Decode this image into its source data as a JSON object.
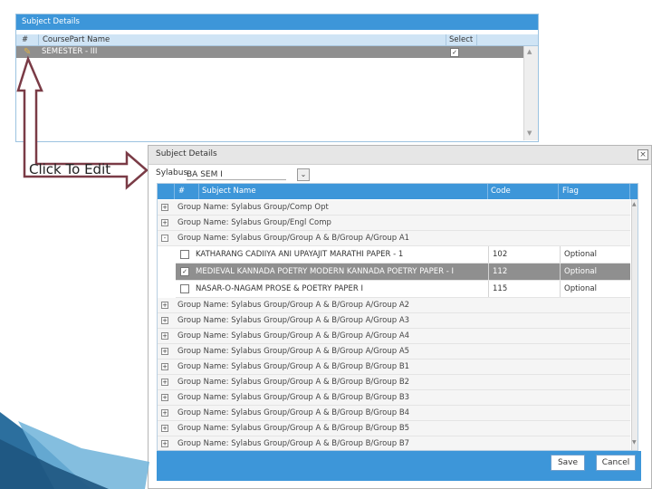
{
  "top_panel": {
    "title": "Subject Details",
    "columns": [
      "#",
      "CoursePart Name",
      "Select"
    ],
    "row": {
      "name": "SEMESTER - III",
      "selected": true
    }
  },
  "annotation": {
    "text": "Click To Edit"
  },
  "dialog": {
    "title": "Subject Details",
    "syllabus_label": "Sylabus",
    "syllabus_value": "BA SEM I",
    "columns": {
      "num": "#",
      "name": "Subject Name",
      "code": "Code",
      "flag": "Flag"
    },
    "groups_top": [
      {
        "label": "Group Name: Sylabus Group/Comp Opt",
        "expander": "+"
      },
      {
        "label": "Group Name: Sylabus Group/Engl Comp",
        "expander": "+"
      },
      {
        "label": "Group Name: Sylabus Group/Group A & B/Group A/Group A1",
        "expander": "-"
      }
    ],
    "subjects": [
      {
        "name": "KATHARANG CADIIYA ANI UPAYAJIT MARATHI PAPER - 1",
        "code": "102",
        "flag": "Optional",
        "checked": false,
        "selected": false
      },
      {
        "name": "MEDIEVAL KANNADA POETRY MODERN KANNADA POETRY PAPER - I",
        "code": "112",
        "flag": "Optional",
        "checked": true,
        "selected": true
      },
      {
        "name": "NASAR-O-NAGAM PROSE & POETRY PAPER I",
        "code": "115",
        "flag": "Optional",
        "checked": false,
        "selected": false
      }
    ],
    "groups_bottom": [
      {
        "label": "Group Name: Sylabus Group/Group A & B/Group A/Group A2",
        "expander": "+"
      },
      {
        "label": "Group Name: Sylabus Group/Group A & B/Group A/Group A3",
        "expander": "+"
      },
      {
        "label": "Group Name: Sylabus Group/Group A & B/Group A/Group A4",
        "expander": "+"
      },
      {
        "label": "Group Name: Sylabus Group/Group A & B/Group A/Group A5",
        "expander": "+"
      },
      {
        "label": "Group Name: Sylabus Group/Group A & B/Group B/Group B1",
        "expander": "+"
      },
      {
        "label": "Group Name: Sylabus Group/Group A & B/Group B/Group B2",
        "expander": "+"
      },
      {
        "label": "Group Name: Sylabus Group/Group A & B/Group B/Group B3",
        "expander": "+"
      },
      {
        "label": "Group Name: Sylabus Group/Group A & B/Group B/Group B4",
        "expander": "+"
      },
      {
        "label": "Group Name: Sylabus Group/Group A & B/Group B/Group B5",
        "expander": "+"
      },
      {
        "label": "Group Name: Sylabus Group/Group A & B/Group B/Group B7",
        "expander": "+"
      }
    ],
    "buttons": {
      "save": "Save",
      "cancel": "Cancel"
    }
  },
  "colors": {
    "accent": "#3d96d9",
    "selected_row": "#8f8f8f",
    "arrow": "#7a3b46"
  }
}
